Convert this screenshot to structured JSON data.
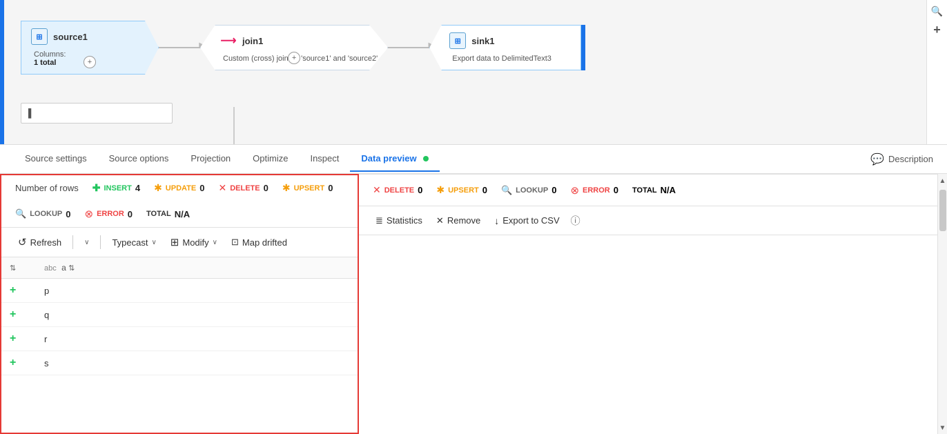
{
  "pipeline": {
    "nodes": [
      {
        "id": "source1",
        "title": "source1",
        "icon_type": "csv",
        "body_label": "Columns:",
        "body_value": "1 total",
        "has_plus": true
      },
      {
        "id": "join1",
        "title": "join1",
        "icon_type": "join",
        "body_text": "Custom (cross) join on 'source1' and 'source2'",
        "has_plus": true
      },
      {
        "id": "sink1",
        "title": "sink1",
        "icon_type": "csv",
        "body_text": "Export data to DelimitedText3",
        "has_plus": false
      }
    ]
  },
  "tabs": {
    "items": [
      {
        "id": "source-settings",
        "label": "Source settings",
        "active": false
      },
      {
        "id": "source-options",
        "label": "Source options",
        "active": false
      },
      {
        "id": "projection",
        "label": "Projection",
        "active": false
      },
      {
        "id": "optimize",
        "label": "Optimize",
        "active": false
      },
      {
        "id": "inspect",
        "label": "Inspect",
        "active": false
      },
      {
        "id": "data-preview",
        "label": "Data preview",
        "active": true
      }
    ],
    "description_label": "Description"
  },
  "stats": {
    "num_rows_label": "Number of rows",
    "insert_label": "INSERT",
    "insert_value": "4",
    "update_label": "UPDATE",
    "update_value": "0",
    "delete_label": "DELETE",
    "delete_value": "0",
    "upsert_label": "UPSERT",
    "upsert_value": "0",
    "lookup_label": "LOOKUP",
    "lookup_value": "0",
    "error_label": "ERROR",
    "error_value": "0",
    "total_label": "TOTAL",
    "total_value": "N/A"
  },
  "toolbar": {
    "refresh_label": "Refresh",
    "typecast_label": "Typecast",
    "modify_label": "Modify",
    "map_drifted_label": "Map drifted",
    "statistics_label": "Statistics",
    "remove_label": "Remove",
    "export_csv_label": "Export to CSV"
  },
  "table": {
    "columns": [
      {
        "sort": true,
        "name": "a",
        "type": "abc",
        "sort2": true
      }
    ],
    "rows": [
      {
        "insert_marker": "+",
        "col_a": "p"
      },
      {
        "insert_marker": "+",
        "col_a": "q"
      },
      {
        "insert_marker": "+",
        "col_a": "r"
      },
      {
        "insert_marker": "+",
        "col_a": "s"
      }
    ]
  },
  "icons": {
    "search": "🔍",
    "plus": "+",
    "comment": "💬",
    "chevron_down": "∨",
    "refresh": "↺",
    "sort_updown": "⇅",
    "info": "ⓘ",
    "close": "✕",
    "download": "↓",
    "table_icon": "⊞",
    "stats_icon": "≣",
    "join_icon": "⟶"
  }
}
